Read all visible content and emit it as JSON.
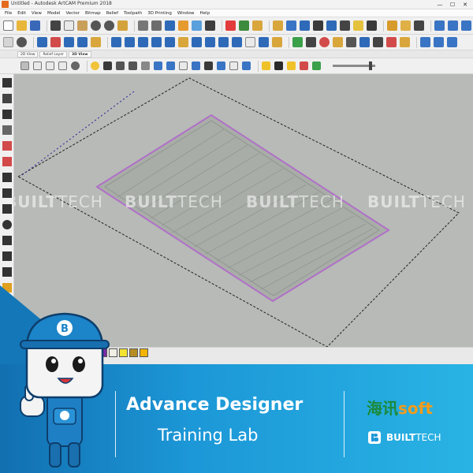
{
  "window": {
    "title": "Untitled - Autodesk ArtCAM Premium 2018",
    "controls": {
      "minimize": "—",
      "maximize": "☐",
      "close": "✕"
    }
  },
  "menu": [
    "File",
    "Edit",
    "View",
    "Model",
    "Vector",
    "Bitmap",
    "Relief",
    "Toolpath",
    "3D Printing",
    "Window",
    "Help"
  ],
  "view_tabs": [
    "2D View",
    "Relief Layer",
    "3D View"
  ],
  "watermark": {
    "bold": "BUILT",
    "light": "TECH"
  },
  "palette": {
    "colors": [
      "#e32a2a",
      "#7b2aa6",
      "#f2efe4",
      "#f3e230",
      "#b58d24",
      "#f2b400"
    ]
  },
  "banner": {
    "title": "Advance Designer",
    "subtitle": "Training Lab",
    "brand_cn": "海讯",
    "brand_soft": "soft",
    "brand_bt_bold": "BUILT",
    "brand_bt_light": "TECH",
    "mascot_badge": "B"
  },
  "colors": {
    "banner_start": "#126fb0",
    "banner_end": "#29b3e4",
    "viewport_bg": "#b7bab6",
    "selection_outline": "#b070c8"
  }
}
